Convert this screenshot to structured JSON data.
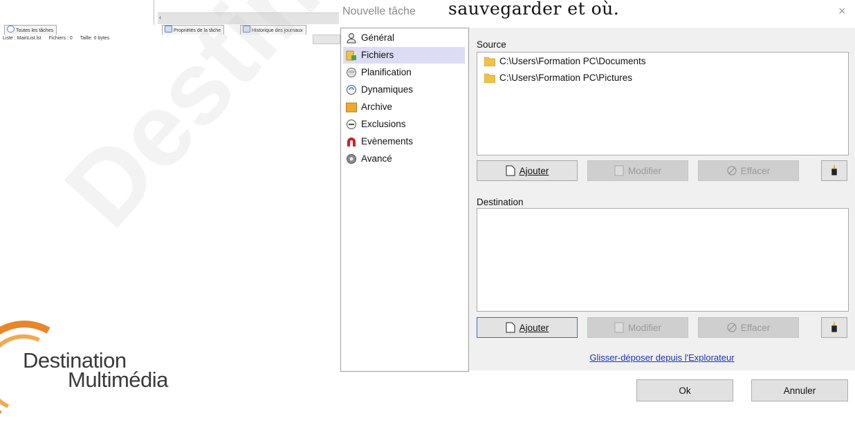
{
  "background_app": {
    "tabs": [
      "Toutes les tâches",
      "Propriétés de la tâche",
      "Historique des journaux"
    ],
    "status": [
      "Liste : MainList.lst",
      "Fichiers : 0",
      "Taille: 0 bytes"
    ],
    "scroll_arrow": "‹"
  },
  "watermark": "Destination",
  "logo": {
    "line1": "Destination",
    "line2": "Multimédia"
  },
  "heading": "sauvegarder et où.",
  "dialog": {
    "title": "Nouvelle tâche",
    "close": "×",
    "nav": [
      {
        "label": "Général",
        "icon": "user-icon"
      },
      {
        "label": "Fichiers",
        "icon": "files-icon",
        "selected": true
      },
      {
        "label": "Planification",
        "icon": "schedule-icon"
      },
      {
        "label": "Dynamiques",
        "icon": "dynamic-icon"
      },
      {
        "label": "Archive",
        "icon": "archive-icon"
      },
      {
        "label": "Exclusions",
        "icon": "exclusion-icon"
      },
      {
        "label": "Evènements",
        "icon": "events-icon"
      },
      {
        "label": "Avancé",
        "icon": "gear-icon"
      }
    ],
    "source": {
      "label": "Source",
      "items": [
        "C:\\Users\\Formation PC\\Documents",
        "C:\\Users\\Formation PC\\Pictures"
      ]
    },
    "destination": {
      "label": "Destination"
    },
    "buttons": {
      "add": "Ajouter",
      "modify": "Modifier",
      "clear": "Effacer"
    },
    "drag_link": "Glisser-déposer depuis l'Explorateur",
    "ok": "Ok",
    "cancel": "Annuler"
  },
  "colors": {
    "accent": "#2d6fd6",
    "selection": "#dcdcf5",
    "logo_orange": "#e8862a",
    "link": "#1a33b8"
  }
}
